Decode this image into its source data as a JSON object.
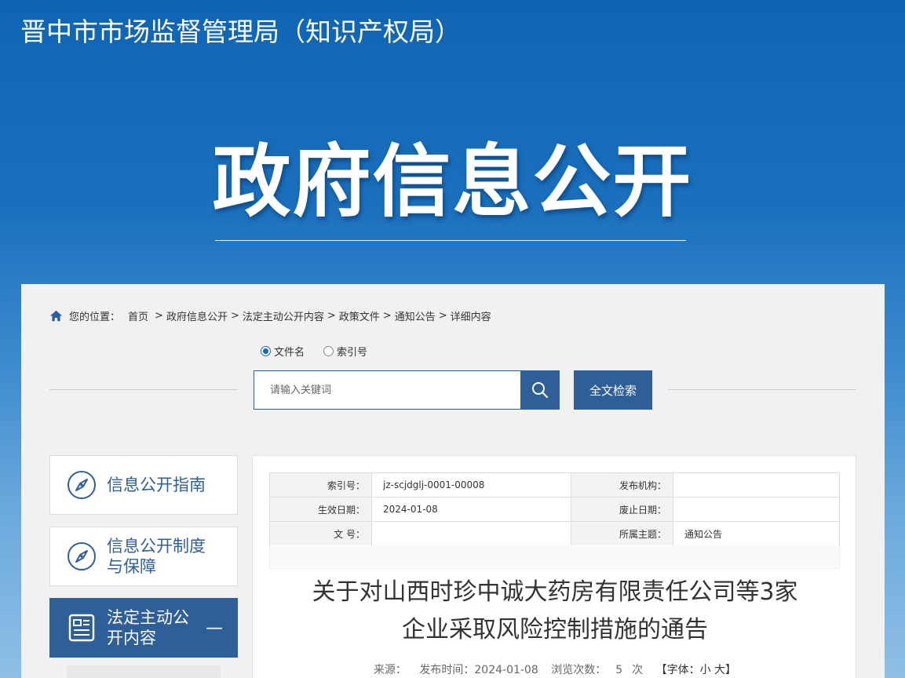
{
  "site_title": "晋中市市场监督管理局（知识产权局）",
  "hero_title": "政府信息公开",
  "breadcrumb": {
    "label": "您的位置：",
    "items": [
      "首页",
      "政府信息公开",
      "法定主动公开内容",
      "政策文件",
      "通知公告",
      "详细内容"
    ]
  },
  "search": {
    "radios": [
      {
        "label": "文件名",
        "checked": true
      },
      {
        "label": "索引号",
        "checked": false
      }
    ],
    "placeholder": "请输入关键词",
    "fulltext_label": "全文检索"
  },
  "sidebar": {
    "items": [
      {
        "label": "信息公开指南",
        "icon": "compass-icon"
      },
      {
        "label": "信息公开制度与保障",
        "icon": "compass-icon"
      },
      {
        "label": "法定主动公开内容",
        "icon": "document-list-icon",
        "active": true
      }
    ]
  },
  "meta": {
    "index_no_label": "索引号：",
    "index_no": "jz-scjdglj-0001-00008",
    "publisher_label": "发布机构：",
    "publisher": "",
    "effective_label": "生效日期：",
    "effective": "2024-01-08",
    "expire_label": "废止日期：",
    "expire": "",
    "doc_no_label": "文 号：",
    "doc_no": "",
    "topic_label": "所属主题：",
    "topic": "通知公告"
  },
  "article": {
    "title_line1": "关于对山西时珍中诚大药房有限责任公司等3家",
    "title_line2": "企业采取风险控制措施的通告",
    "source_label": "来源：",
    "publish_label": "发布时间：2024-01-08",
    "views_label": "浏览次数：",
    "views": "5",
    "views_unit": "次",
    "font_label": "【字体：小 大】"
  },
  "colors": {
    "primary": "#2f5f98",
    "accent_radio": "#1a66c8"
  }
}
